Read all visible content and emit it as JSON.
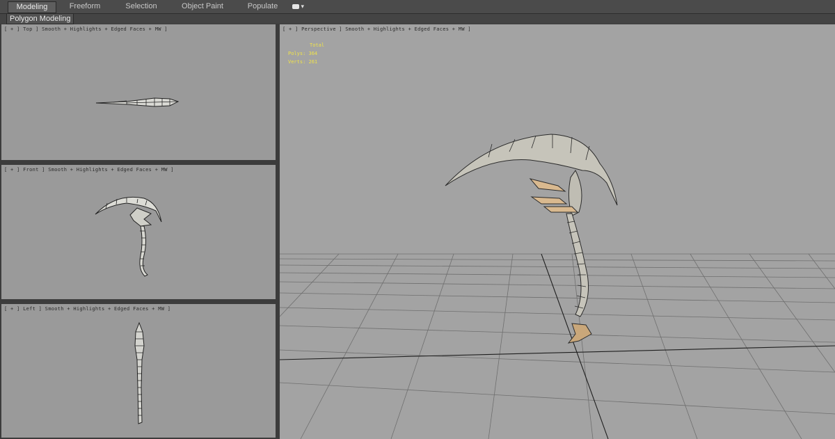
{
  "ribbon": {
    "tabs": [
      {
        "label": "Modeling",
        "active": true
      },
      {
        "label": "Freeform",
        "active": false
      },
      {
        "label": "Selection",
        "active": false
      },
      {
        "label": "Object Paint",
        "active": false
      },
      {
        "label": "Populate",
        "active": false
      }
    ],
    "dropdown_icon": "toggle-dropdown-icon",
    "panel_label": "Polygon Modeling"
  },
  "viewports": {
    "top": {
      "label": "[ + ] Top ] Smooth + Highlights + Edged Faces + MW ]"
    },
    "front": {
      "label": "[ + ] Front ] Smooth + Highlights + Edged Faces + MW ]"
    },
    "left": {
      "label": "[ + ] Left ] Smooth + Highlights + Edged Faces + MW ]"
    },
    "perspective": {
      "label": "[ + ] Perspective ] Smooth + Highlights + Edged Faces + MW ]",
      "stats": {
        "header": "Total",
        "polys": "Polys: 364",
        "verts": "Verts: 261"
      }
    }
  },
  "colors": {
    "viewport_bg": "#9a9a9a",
    "stats_text": "#f0e34a",
    "ui_bg": "#444444"
  }
}
